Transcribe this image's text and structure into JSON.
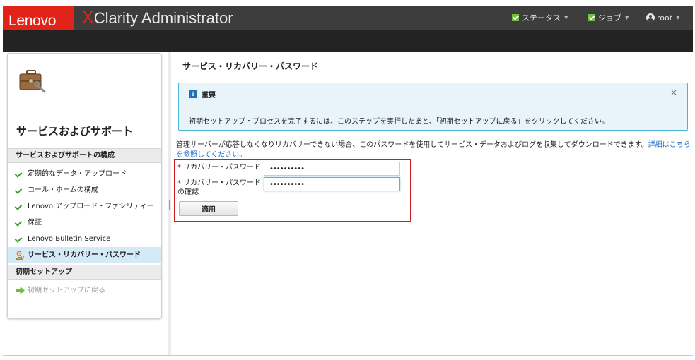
{
  "header": {
    "brand": "Lenovo",
    "brand_mark": ".",
    "product_x": "X",
    "product_rest": "Clarity",
    "product_suffix": " Administrator",
    "status_label": "ステータス",
    "jobs_label": "ジョブ",
    "user_label": "root"
  },
  "sidebar": {
    "title": "サービスおよびサポート",
    "section1": "サービスおよびサポートの構成",
    "items": [
      {
        "label": "定期的なデータ・アップロード"
      },
      {
        "label": "コール・ホームの構成"
      },
      {
        "label": "Lenovo アップロード・ファシリティー"
      },
      {
        "label": "保証"
      },
      {
        "label": "Lenovo Bulletin Service"
      },
      {
        "label": "サービス・リカバリー・パスワード"
      }
    ],
    "section2": "初期セットアップ",
    "back_link": "初期セットアップに戻る"
  },
  "main": {
    "title": "サービス・リカバリー・パスワード",
    "notice": {
      "heading": "重要",
      "close": "×",
      "icon_glyph": "i",
      "body": "初期セットアップ・プロセスを完了するには、このステップを実行したあと、「初期セットアップに戻る」をクリックしてください。"
    },
    "description": "管理サーバーが応答しなくなりリカバリーできない場合、このパスワードを使用してサービス・データおよびログを収集してダウンロードできます。",
    "description_link": "詳細はこちらを参照してください。",
    "required_mark": "*",
    "password_label": "リカバリー・パスワード",
    "password_value": "••••••••••",
    "confirm_label_line1": "リカバリー・パスワード",
    "confirm_label_line2": "の確認",
    "confirm_value": "••••••••••",
    "apply_label": "適用"
  },
  "colors": {
    "lenovo_red": "#e2231a",
    "header_bg": "#3d3d3d",
    "check_green": "#3d9a2b",
    "info_blue": "#1d70b8",
    "link_blue": "#1d6fc2",
    "highlight_red": "#cc1e1e"
  },
  "icons": {
    "sidebar_header": "toolbox-icon",
    "status": "checkbox-check-icon",
    "jobs": "checkbox-check-icon",
    "user": "user-circle-icon",
    "done": "checkmark-icon",
    "active": "person-key-icon",
    "back": "green-arrow-icon",
    "notice": "info-icon",
    "close": "close-icon"
  }
}
